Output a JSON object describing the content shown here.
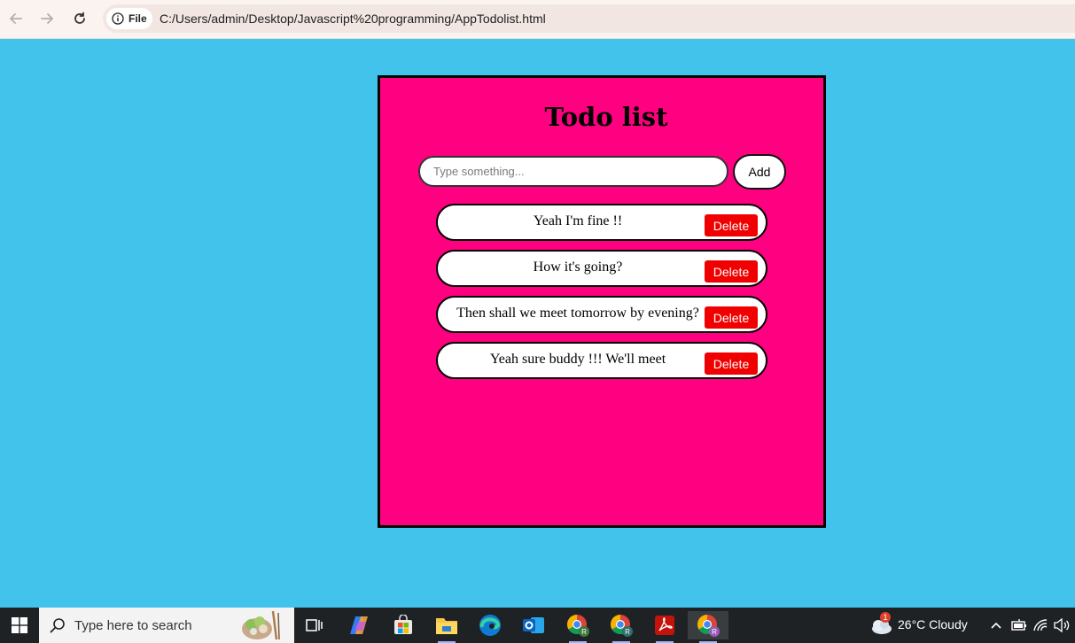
{
  "browser": {
    "site_chip_label": "File",
    "url": "C:/Users/admin/Desktop/Javascript%20programming/AppTodolist.html"
  },
  "app": {
    "title": "Todo list",
    "input_placeholder": "Type something...",
    "input_value": "",
    "add_label": "Add",
    "items": [
      {
        "text": "Yeah I'm fine !!",
        "delete_label": "Delete"
      },
      {
        "text": "How it's going?",
        "delete_label": "Delete"
      },
      {
        "text": "Then shall we meet tomorrow by evening?",
        "delete_label": "Delete"
      },
      {
        "text": "Yeah sure buddy !!! We'll meet",
        "delete_label": "Delete"
      }
    ],
    "colors": {
      "page_bg": "#41c3ec",
      "card_bg": "#ff0080",
      "delete_bg": "#f00000"
    }
  },
  "taskbar": {
    "search_placeholder": "Type here to search",
    "weather_badge": "1",
    "weather": "26°C  Cloudy",
    "pinned": [
      "task-view-icon",
      "copilot-icon",
      "store-icon",
      "file-explorer-icon",
      "edge-icon",
      "outlook-icon",
      "chrome-profile-icon",
      "chrome-profile-icon",
      "acrobat-icon",
      "chrome-profile-icon"
    ]
  }
}
